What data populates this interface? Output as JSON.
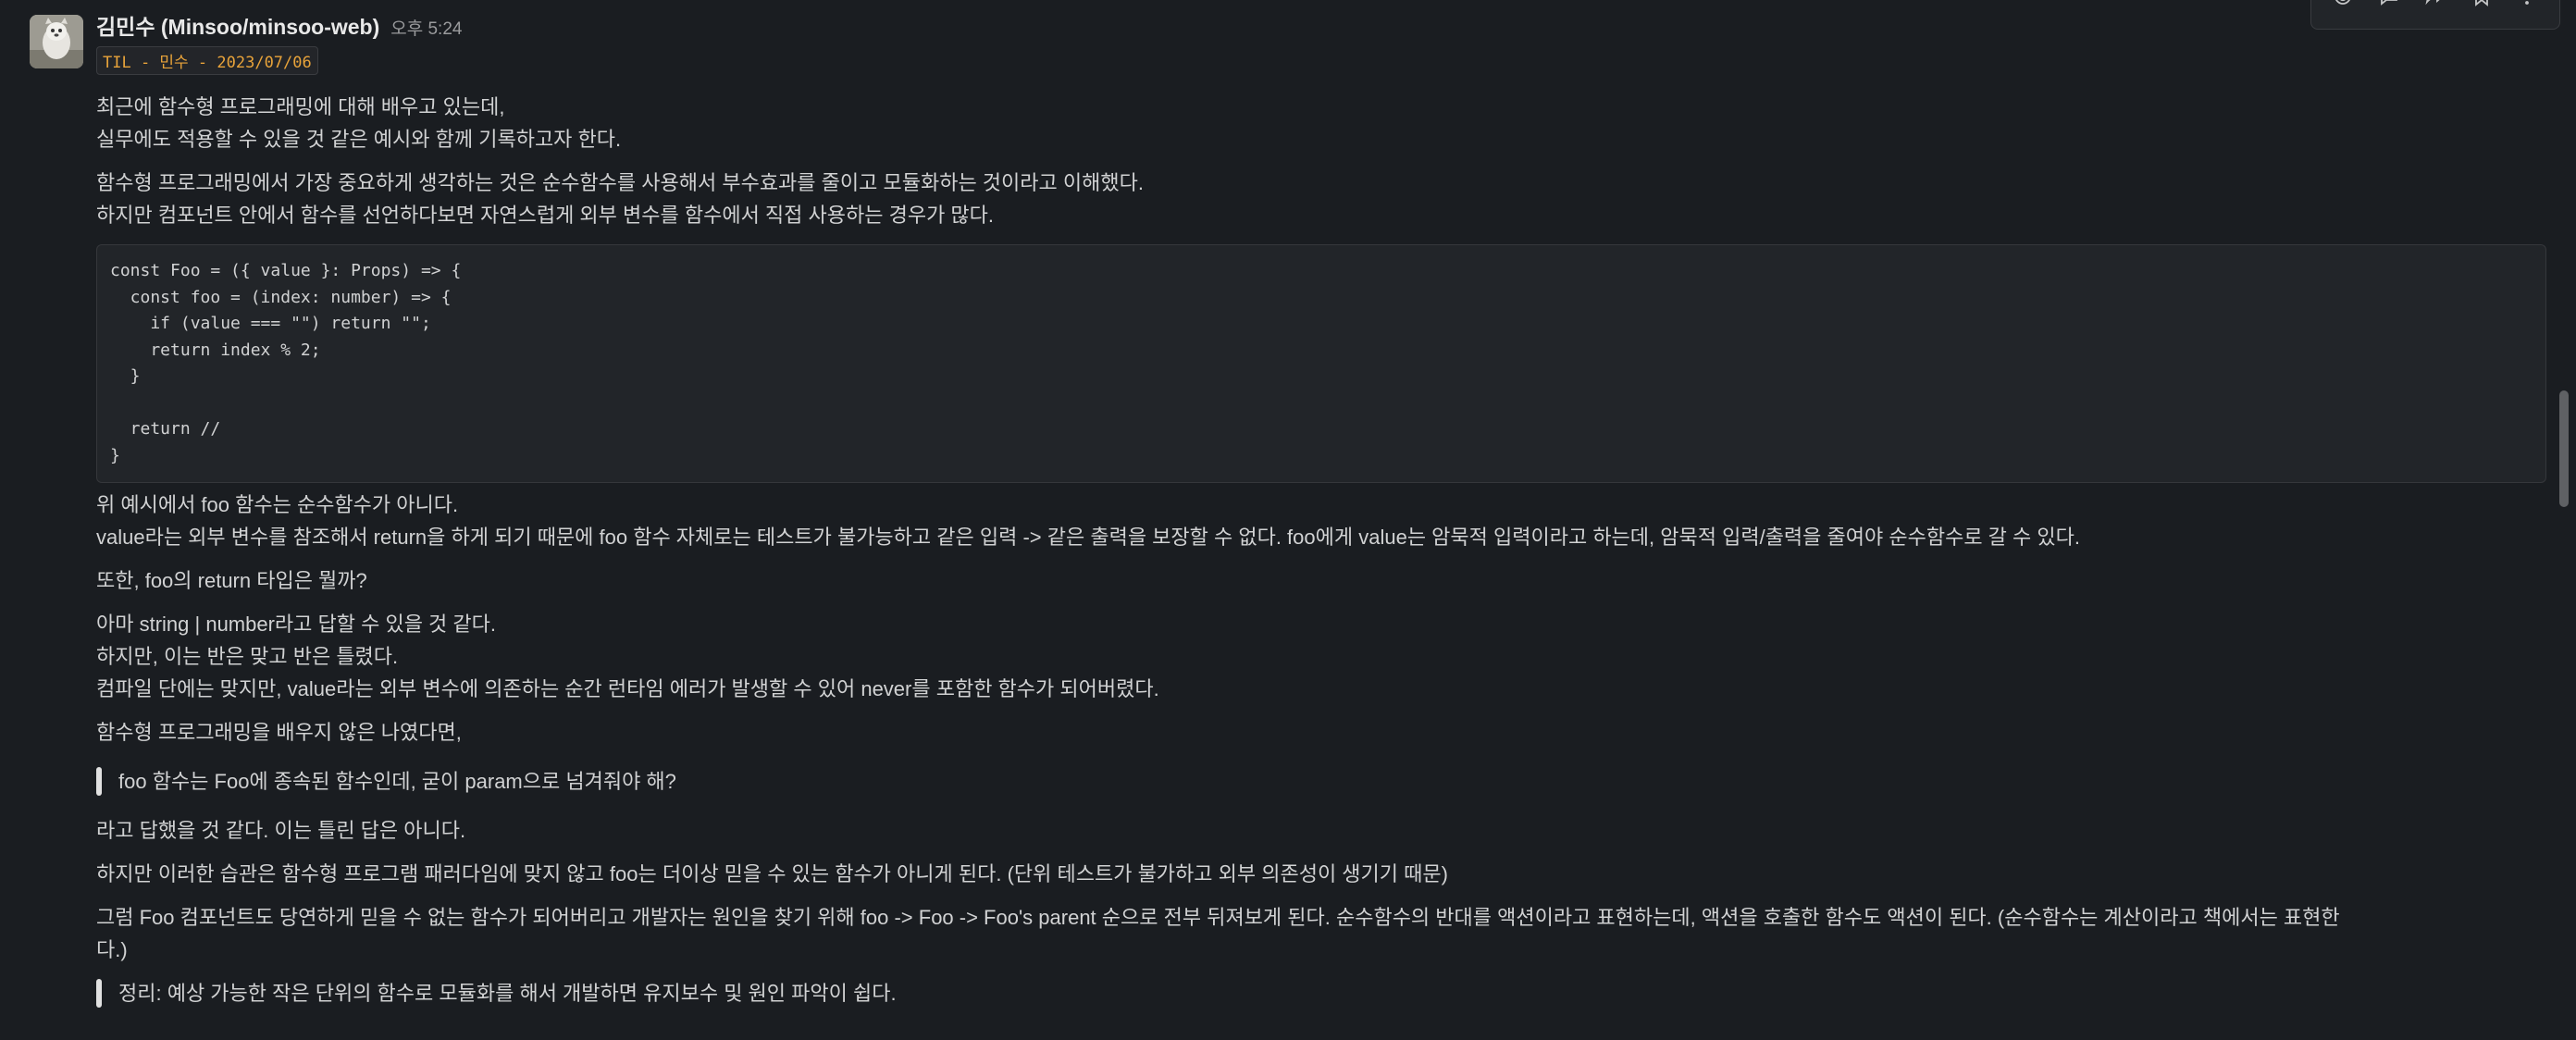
{
  "message": {
    "sender": "김민수 (Minsoo/minsoo-web)",
    "time": "오후 5:24",
    "tag": "TIL - 민수 - 2023/07/06",
    "intro": [
      "최근에 함수형 프로그래밍에 대해 배우고 있는데,",
      "실무에도 적용할 수 있을 것 같은 예시와 함께 기록하고자 한다."
    ],
    "para2": [
      "함수형 프로그래밍에서 가장 중요하게 생각하는 것은 순수함수를 사용해서 부수효과를 줄이고 모듈화하는 것이라고 이해했다.",
      "하지만 컴포넌트 안에서 함수를 선언하다보면 자연스럽게 외부 변수를 함수에서 직접 사용하는 경우가 많다."
    ],
    "code": [
      "const Foo = ({ value }: Props) => {",
      "  const foo = (index: number) => {",
      "    if (value === \"\") return \"\";",
      "    return index % 2;",
      "  }",
      "",
      "  return //",
      "}"
    ],
    "para3": [
      "위 예시에서 foo 함수는 순수함수가 아니다.",
      "value라는 외부 변수를 참조해서 return을 하게 되기 때문에 foo 함수 자체로는 테스트가 불가능하고 같은 입력 -> 같은 출력을 보장할 수 없다. foo에게 value는 암묵적 입력이라고 하는데, 암묵적 입력/출력을 줄여야 순수함수로 갈 수 있다."
    ],
    "para4": "또한, foo의 return 타입은 뭘까?",
    "para5": [
      "아마 string | number라고 답할 수 있을 것 같다.",
      "하지만, 이는 반은 맞고 반은 틀렸다.",
      "컴파일 단에는 맞지만, value라는 외부 변수에 의존하는 순간 런타임 에러가 발생할 수 있어 never를 포함한 함수가 되어버렸다."
    ],
    "para6": "함수형 프로그래밍을 배우지 않은 나였다면,",
    "quote1": "foo 함수는 Foo에 종속된 함수인데, 굳이 param으로 넘겨줘야 해?",
    "para7": "라고 답했을 것 같다. 이는 틀린 답은 아니다.",
    "para8": "하지만 이러한 습관은 함수형 프로그램 패러다임에 맞지 않고 foo는 더이상 믿을 수 있는 함수가 아니게 된다. (단위 테스트가 불가하고 외부 의존성이 생기기 때문)",
    "para9": [
      "그럼 Foo 컴포넌트도 당연하게 믿을 수 없는 함수가 되어버리고 개발자는 원인을 찾기 위해 foo -> Foo -> Foo's parent 순으로 전부 뒤져보게 된다. 순수함수의 반대를 액션이라고 표현하는데, 액션을 호출한 함수도 액션이 된다. (순수함수는 계산이라고 책에서는 표현한",
      "다.)"
    ],
    "quote2": "정리: 예상 가능한 작은 단위의 함수로 모듈화를 해서 개발하면 유지보수 및 원인 파악이 쉽다."
  },
  "toolbar": {
    "icons": [
      "add-reaction-icon",
      "reply-in-thread-icon",
      "share-message-icon",
      "save-bookmark-icon",
      "more-actions-icon"
    ]
  }
}
